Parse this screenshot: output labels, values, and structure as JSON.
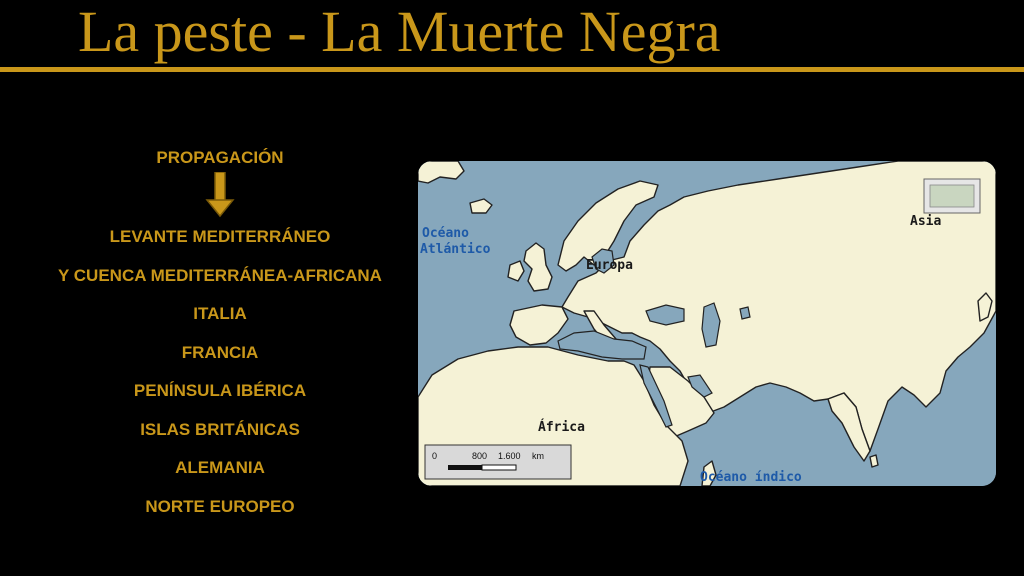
{
  "slide": {
    "title": "La peste - La Muerte Negra"
  },
  "sidebar": {
    "heading": "PROPAGACIÓN",
    "regions": [
      "LEVANTE MEDITERRÁNEO",
      "Y CUENCA MEDITERRÁNEA-AFRICANA",
      "ITALIA",
      "FRANCIA",
      "PENÍNSULA IBÉRICA",
      "ISLAS BRITÁNICAS",
      "ALEMANIA",
      "NORTE EUROPEO"
    ]
  },
  "map": {
    "labels": {
      "atlantic_line1": "Océano",
      "atlantic_line2": "Atlántico",
      "europe": "Europa",
      "asia": "Asia",
      "africa": "África",
      "indian": "Océano índico"
    },
    "scale": {
      "zero": "0",
      "mark1": "800",
      "mark2": "1.600",
      "unit": "km"
    }
  },
  "colors": {
    "accent": "#c9971a",
    "background": "#000000",
    "land": "#f5f2d6",
    "sea": "#86a7bc",
    "map_label_blue": "#1e5aa8",
    "map_label_dark": "#1a1a1a"
  }
}
